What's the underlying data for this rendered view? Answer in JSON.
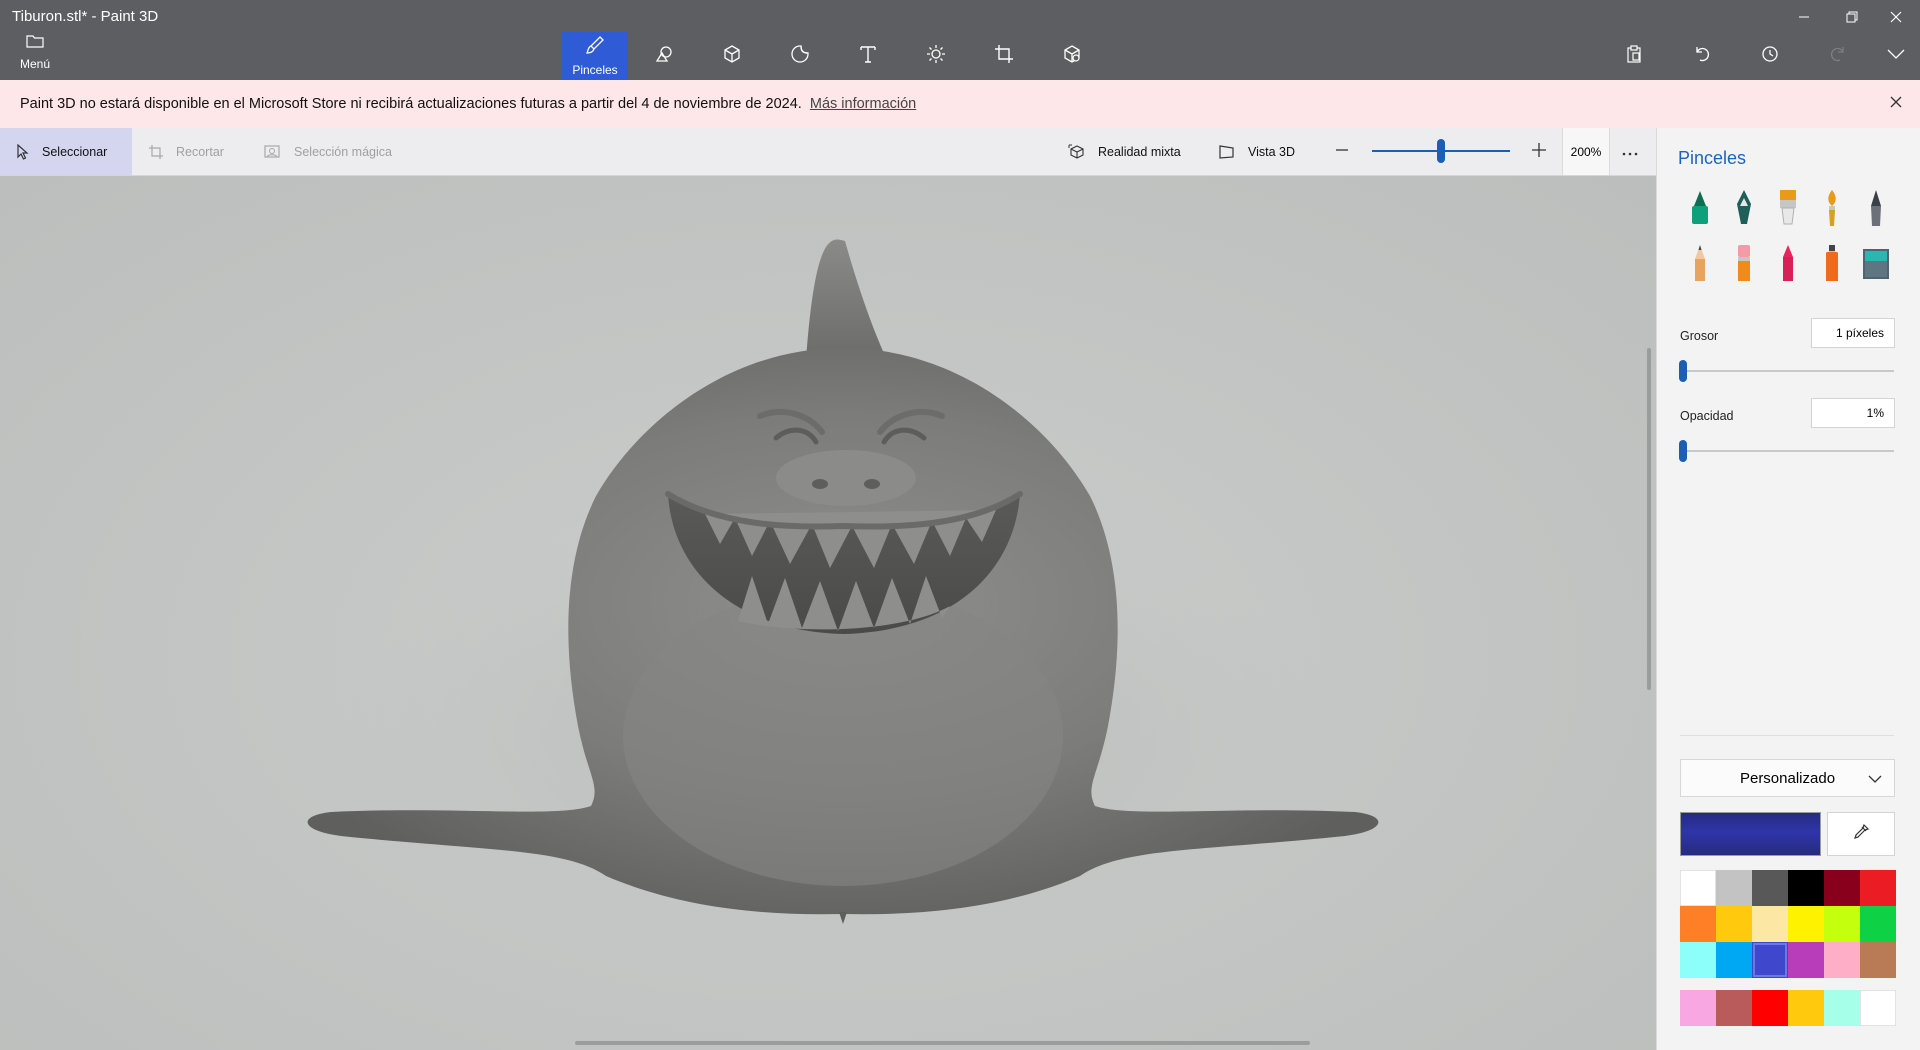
{
  "window": {
    "title": "Tiburon.stl* - Paint 3D"
  },
  "menu": {
    "label": "Menú"
  },
  "toolbar": {
    "active_label": "Pinceles",
    "tools": [
      "brush-icon",
      "shapes-2d-icon",
      "shapes-3d-icon",
      "stickers-icon",
      "text-icon",
      "effects-icon",
      "canvas-icon",
      "library-3d-icon"
    ],
    "right_tools": [
      "paste-icon",
      "undo-icon",
      "history-icon",
      "redo-icon",
      "expand-icon"
    ]
  },
  "banner": {
    "message": "Paint 3D no estará disponible en el Microsoft Store ni recibirá actualizaciones futuras a partir del 4 de noviembre de 2024.",
    "link": "Más información"
  },
  "subtoolbar": {
    "select": "Seleccionar",
    "crop": "Recortar",
    "magic_select": "Selección mágica",
    "mixed_reality": "Realidad mixta",
    "view3d": "Vista 3D",
    "zoom": "200%",
    "zoom_level": 0.5
  },
  "panel": {
    "title": "Pinceles",
    "brushes": [
      "marker-icon",
      "calligraphy-pen-icon",
      "oil-brush-icon",
      "watercolor-icon",
      "pixel-pen-icon",
      "pencil-icon",
      "eraser-icon",
      "crayon-icon",
      "spray-can-icon",
      "fill-bucket-icon"
    ],
    "thickness_label": "Grosor",
    "thickness_value": "1 píxeles",
    "thickness_level": 0,
    "opacity_label": "Opacidad",
    "opacity_value": "1%",
    "opacity_level": 0,
    "dropdown": "Personalizado",
    "current_color": "#262b80",
    "palette_main": [
      "#ffffff",
      "#c3c3c3",
      "#585858",
      "#000000",
      "#88001b",
      "#ec1c24",
      "#ff7f27",
      "#ffc90e",
      "#fde7a4",
      "#fff200",
      "#c4ff0e",
      "#0ed145",
      "#8cfffb",
      "#00a8f3",
      "#3f48cc",
      "#b83dba",
      "#ffaec8",
      "#b97a56"
    ],
    "selected_swatch": 14,
    "palette_custom": [
      "#f9a7e3",
      "#b95b5b",
      "#ff0000",
      "#ffc90e",
      "#a6ffe8",
      "#ffffff"
    ]
  }
}
